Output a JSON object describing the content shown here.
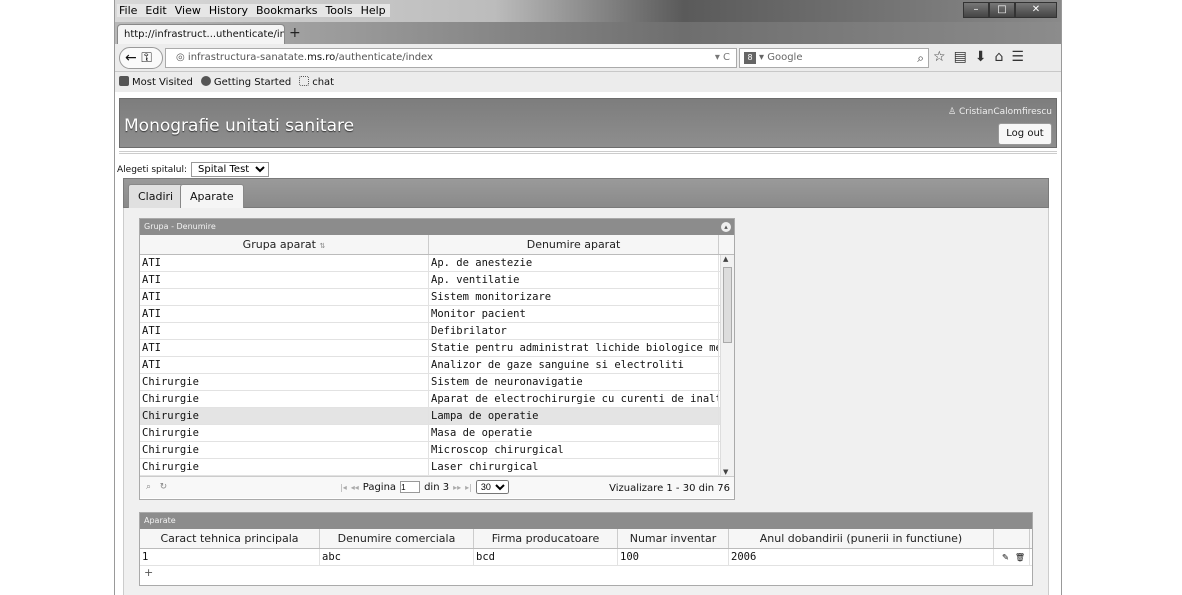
{
  "browser": {
    "menu": [
      "File",
      "Edit",
      "View",
      "History",
      "Bookmarks",
      "Tools",
      "Help"
    ],
    "tab_title": "http://infrastruct...uthenticate/index",
    "url_prefix": "infrastructura-sanatate.",
    "url_domain": "ms.ro",
    "url_path": "/authenticate/index",
    "search_placeholder": "Google",
    "bookmarks": [
      "Most Visited",
      "Getting Started",
      "chat"
    ]
  },
  "app": {
    "title": "Monografie unitati sanitare",
    "username": "CristianCalomfirescu",
    "logout_label": "Log out",
    "hospital_label": "Alegeti spitalul:",
    "hospital_value": "Spital Test",
    "tabs": [
      {
        "label": "Cladiri",
        "active": false
      },
      {
        "label": "Aparate",
        "active": true
      }
    ]
  },
  "grid1": {
    "caption": "Grupa - Denumire",
    "headers": [
      "Grupa aparat",
      "Denumire aparat"
    ],
    "rows": [
      [
        "ATI",
        "Ap. de anestezie"
      ],
      [
        "ATI",
        "Ap. ventilatie"
      ],
      [
        "ATI",
        "Sistem monitorizare"
      ],
      [
        "ATI",
        "Monitor pacient"
      ],
      [
        "ATI",
        "Defibrilator"
      ],
      [
        "ATI",
        "Statie pentru administrat lichide biologice medicamer"
      ],
      [
        "ATI",
        "Analizor de gaze sanguine si electroliti"
      ],
      [
        "Chirurgie",
        "Sistem de neuronavigatie"
      ],
      [
        "Chirurgie",
        "Aparat  de electrochirurgie cu curenti de inalta frecve"
      ],
      [
        "Chirurgie",
        "Lampa de operatie"
      ],
      [
        "Chirurgie",
        "Masa de operatie"
      ],
      [
        "Chirurgie",
        "Microscop chirurgical"
      ],
      [
        "Chirurgie",
        "Laser chirurgical"
      ]
    ],
    "selected_row": 9,
    "pager": {
      "page_label": "Pagina",
      "page_value": "1",
      "of_label": "din 3",
      "rows_per_page": "30",
      "summary": "Vizualizare 1 - 30 din 76"
    }
  },
  "grid2": {
    "caption": "Aparate",
    "headers": [
      "Caract tehnica principala",
      "Denumire comerciala",
      "Firma producatoare",
      "Numar inventar",
      "Anul dobandirii (punerii in functiune)"
    ],
    "rows": [
      [
        "1",
        "abc",
        "bcd",
        "100",
        "2006"
      ]
    ],
    "add_label": "+"
  }
}
